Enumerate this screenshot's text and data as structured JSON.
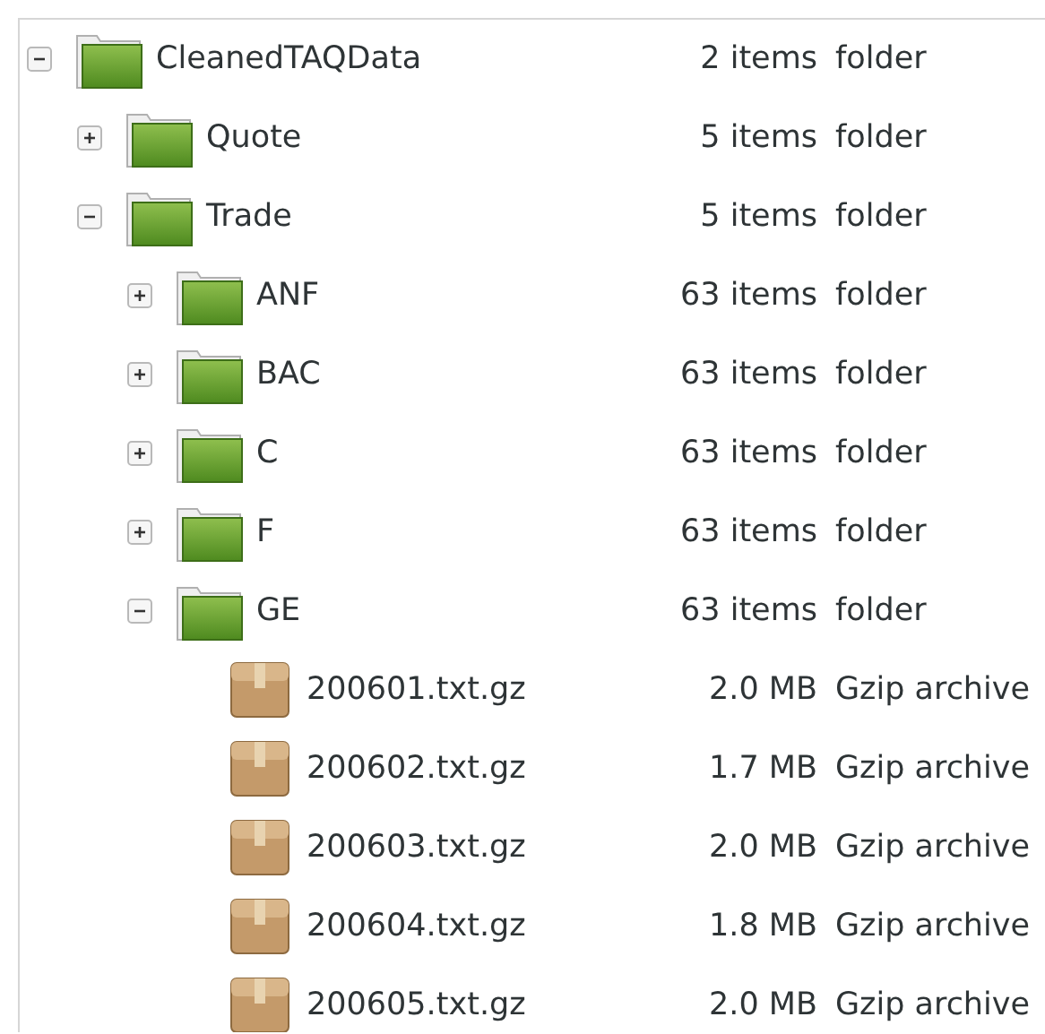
{
  "tree": [
    {
      "name": "CleanedTAQData",
      "size": "2 items",
      "type": "folder",
      "kind": "folder",
      "expanded": true,
      "children": [
        {
          "name": "Quote",
          "size": "5 items",
          "type": "folder",
          "kind": "folder",
          "expanded": false
        },
        {
          "name": "Trade",
          "size": "5 items",
          "type": "folder",
          "kind": "folder",
          "expanded": true,
          "children": [
            {
              "name": "ANF",
              "size": "63 items",
              "type": "folder",
              "kind": "folder",
              "expanded": false
            },
            {
              "name": "BAC",
              "size": "63 items",
              "type": "folder",
              "kind": "folder",
              "expanded": false
            },
            {
              "name": "C",
              "size": "63 items",
              "type": "folder",
              "kind": "folder",
              "expanded": false
            },
            {
              "name": "F",
              "size": "63 items",
              "type": "folder",
              "kind": "folder",
              "expanded": false
            },
            {
              "name": "GE",
              "size": "63 items",
              "type": "folder",
              "kind": "folder",
              "expanded": true,
              "children": [
                {
                  "name": "200601.txt.gz",
                  "size": "2.0 MB",
                  "type": "Gzip archive",
                  "kind": "file"
                },
                {
                  "name": "200602.txt.gz",
                  "size": "1.7 MB",
                  "type": "Gzip archive",
                  "kind": "file"
                },
                {
                  "name": "200603.txt.gz",
                  "size": "2.0 MB",
                  "type": "Gzip archive",
                  "kind": "file"
                },
                {
                  "name": "200604.txt.gz",
                  "size": "1.8 MB",
                  "type": "Gzip archive",
                  "kind": "file"
                },
                {
                  "name": "200605.txt.gz",
                  "size": "2.0 MB",
                  "type": "Gzip archive",
                  "kind": "file"
                }
              ]
            }
          ]
        }
      ]
    }
  ]
}
